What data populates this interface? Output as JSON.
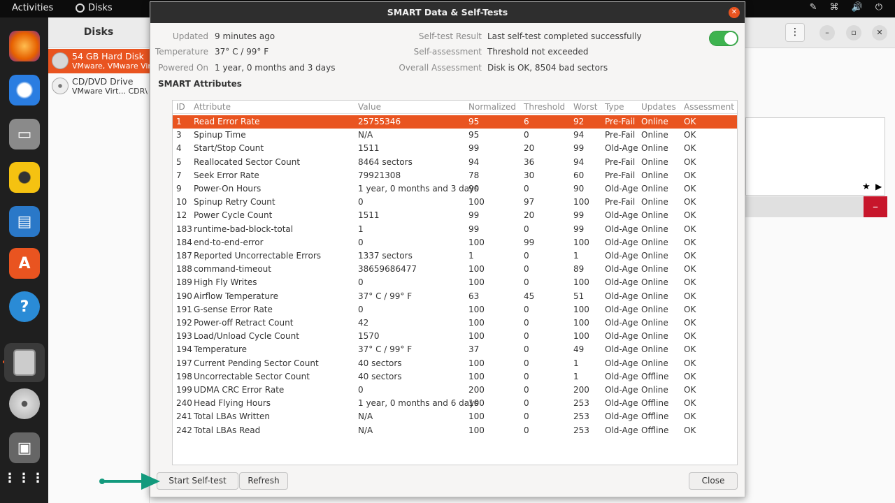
{
  "topbar": {
    "activities": "Activities",
    "app_name": "Disks"
  },
  "sidebar": {
    "header": "Disks",
    "drives": [
      {
        "name": "54 GB Hard Disk",
        "sub": "VMware, VMware Vir"
      },
      {
        "name": "CD/DVD Drive",
        "sub": "VMware Virt...   CDR\\"
      }
    ]
  },
  "dialog": {
    "title": "SMART Data & Self-Tests",
    "updated_label": "Updated",
    "updated": "9 minutes ago",
    "temperature_label": "Temperature",
    "temperature": "37° C / 99° F",
    "powered_on_label": "Powered On",
    "powered_on": "1 year, 0 months and 3 days",
    "selftest_result_label": "Self-test Result",
    "selftest_result": "Last self-test completed successfully",
    "self_assessment_label": "Self-assessment",
    "self_assessment": "Threshold not exceeded",
    "overall_label": "Overall Assessment",
    "overall": "Disk is OK, 8504 bad sectors",
    "smart_enabled": true,
    "section_title": "SMART Attributes",
    "columns": [
      "ID",
      "Attribute",
      "Value",
      "Normalized",
      "Threshold",
      "Worst",
      "Type",
      "Updates",
      "Assessment"
    ],
    "rows": [
      [
        "1",
        "Read Error Rate",
        "25755346",
        "95",
        "6",
        "92",
        "Pre-Fail",
        "Online",
        "OK"
      ],
      [
        "3",
        "Spinup Time",
        "N/A",
        "95",
        "0",
        "94",
        "Pre-Fail",
        "Online",
        "OK"
      ],
      [
        "4",
        "Start/Stop Count",
        "1511",
        "99",
        "20",
        "99",
        "Old-Age",
        "Online",
        "OK"
      ],
      [
        "5",
        "Reallocated Sector Count",
        "8464 sectors",
        "94",
        "36",
        "94",
        "Pre-Fail",
        "Online",
        "OK"
      ],
      [
        "7",
        "Seek Error Rate",
        "79921308",
        "78",
        "30",
        "60",
        "Pre-Fail",
        "Online",
        "OK"
      ],
      [
        "9",
        "Power-On Hours",
        "1 year, 0 months and 3 days",
        "90",
        "0",
        "90",
        "Old-Age",
        "Online",
        "OK"
      ],
      [
        "10",
        "Spinup Retry Count",
        "0",
        "100",
        "97",
        "100",
        "Pre-Fail",
        "Online",
        "OK"
      ],
      [
        "12",
        "Power Cycle Count",
        "1511",
        "99",
        "20",
        "99",
        "Old-Age",
        "Online",
        "OK"
      ],
      [
        "183",
        "runtime-bad-block-total",
        "1",
        "99",
        "0",
        "99",
        "Old-Age",
        "Online",
        "OK"
      ],
      [
        "184",
        "end-to-end-error",
        "0",
        "100",
        "99",
        "100",
        "Old-Age",
        "Online",
        "OK"
      ],
      [
        "187",
        "Reported Uncorrectable Errors",
        "1337 sectors",
        "1",
        "0",
        "1",
        "Old-Age",
        "Online",
        "OK"
      ],
      [
        "188",
        "command-timeout",
        "38659686477",
        "100",
        "0",
        "89",
        "Old-Age",
        "Online",
        "OK"
      ],
      [
        "189",
        "High Fly Writes",
        "0",
        "100",
        "0",
        "100",
        "Old-Age",
        "Online",
        "OK"
      ],
      [
        "190",
        "Airflow Temperature",
        "37° C / 99° F",
        "63",
        "45",
        "51",
        "Old-Age",
        "Online",
        "OK"
      ],
      [
        "191",
        "G-sense Error Rate",
        "0",
        "100",
        "0",
        "100",
        "Old-Age",
        "Online",
        "OK"
      ],
      [
        "192",
        "Power-off Retract Count",
        "42",
        "100",
        "0",
        "100",
        "Old-Age",
        "Online",
        "OK"
      ],
      [
        "193",
        "Load/Unload Cycle Count",
        "1570",
        "100",
        "0",
        "100",
        "Old-Age",
        "Online",
        "OK"
      ],
      [
        "194",
        "Temperature",
        "37° C / 99° F",
        "37",
        "0",
        "49",
        "Old-Age",
        "Online",
        "OK"
      ],
      [
        "197",
        "Current Pending Sector Count",
        "40 sectors",
        "100",
        "0",
        "1",
        "Old-Age",
        "Online",
        "OK"
      ],
      [
        "198",
        "Uncorrectable Sector Count",
        "40 sectors",
        "100",
        "0",
        "1",
        "Old-Age",
        "Offline",
        "OK"
      ],
      [
        "199",
        "UDMA CRC Error Rate",
        "0",
        "200",
        "0",
        "200",
        "Old-Age",
        "Online",
        "OK"
      ],
      [
        "240",
        "Head Flying Hours",
        "1 year, 0 months and 6 days",
        "100",
        "0",
        "253",
        "Old-Age",
        "Offline",
        "OK"
      ],
      [
        "241",
        "Total LBAs Written",
        "N/A",
        "100",
        "0",
        "253",
        "Old-Age",
        "Offline",
        "OK"
      ],
      [
        "242",
        "Total LBAs Read",
        "N/A",
        "100",
        "0",
        "253",
        "Old-Age",
        "Offline",
        "OK"
      ]
    ],
    "start_selftest": "Start Self-test",
    "refresh": "Refresh",
    "close": "Close"
  },
  "colors": {
    "accent": "#e95420",
    "toggle_on": "#3eb34f",
    "arrow": "#139a7d"
  }
}
